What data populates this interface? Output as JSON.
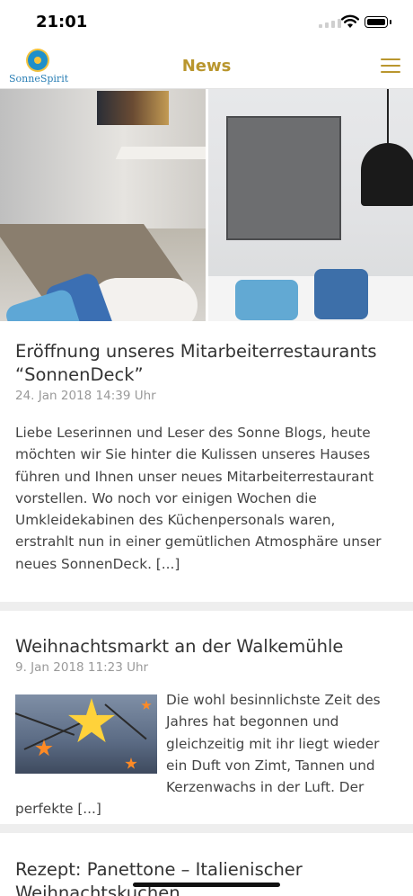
{
  "status_bar": {
    "time": "21:01"
  },
  "nav": {
    "logo_text": "SonneSpirit",
    "title": "News",
    "menu_icon": "hamburger-menu-icon"
  },
  "colors": {
    "accent": "#b9962e",
    "logo_blue": "#2a7fb5",
    "separator": "#eeeeee"
  },
  "articles": [
    {
      "title": "Eröffnung unseres Mitarbeiterrestaurants “SonnenDeck”",
      "date": "24. Jan 2018 14:39 Uhr",
      "excerpt": "Liebe Leserinnen und Leser des Sonne Blogs, heute möchten wir Sie hinter die Kulissen unseres Hauses führen und Ihnen unser neues Mitarbeiterrestaurant vorstellen. Wo noch vor einigen Wochen die Umkleidekabinen des Küchenpersonals waren, erstrahlt nun in einer gemütlichen Atmosphäre unser neues SonnenDeck. [...]"
    },
    {
      "title": "Weihnachtsmarkt an der Walkemühle",
      "date": "9. Jan 2018 11:23 Uhr",
      "excerpt": "Die wohl besinnlichste Zeit des Jahres hat begonnen und gleichzeitig mit ihr liegt wieder ein Duft von Zimt, Tannen und Kerzenwachs in der Luft. Der perfekte [...]"
    },
    {
      "title": "Rezept: Panettone – Italienischer Weihnachtskuchen"
    }
  ]
}
